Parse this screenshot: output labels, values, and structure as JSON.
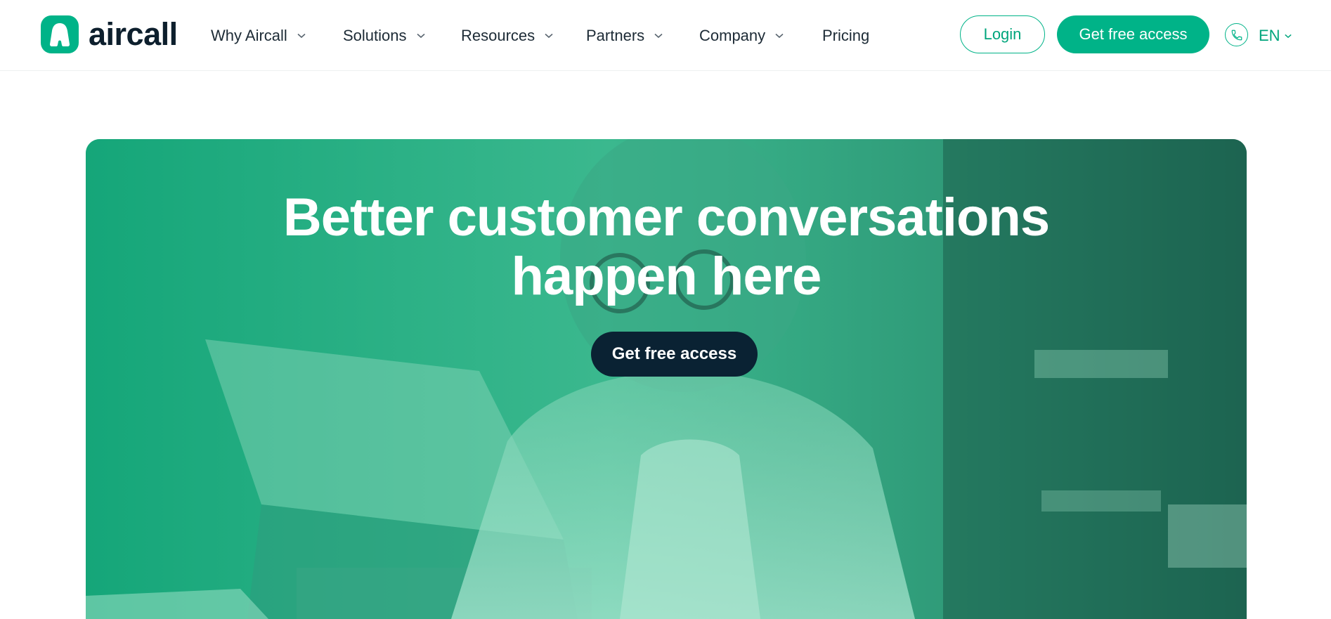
{
  "header": {
    "logo": {
      "text": "aircall",
      "icon": "aircall-logo-icon",
      "color": "#00b388"
    },
    "nav": [
      {
        "label": "Why Aircall",
        "has_dropdown": true
      },
      {
        "label": "Solutions",
        "has_dropdown": true
      },
      {
        "label": "Resources",
        "has_dropdown": true
      },
      {
        "label": "Partners",
        "has_dropdown": true
      },
      {
        "label": "Company",
        "has_dropdown": true
      },
      {
        "label": "Pricing",
        "has_dropdown": false
      }
    ],
    "login_label": "Login",
    "cta_label": "Get free access",
    "phone_icon": "phone-icon",
    "language": "EN"
  },
  "hero": {
    "title_line1": "Better customer conversations",
    "title_line2": "happen here",
    "cta_label": "Get free access",
    "overlay_color": "#1aa97e",
    "cta_color": "#0a2233"
  },
  "colors": {
    "brand": "#00b388",
    "dark": "#0d1f2d"
  }
}
